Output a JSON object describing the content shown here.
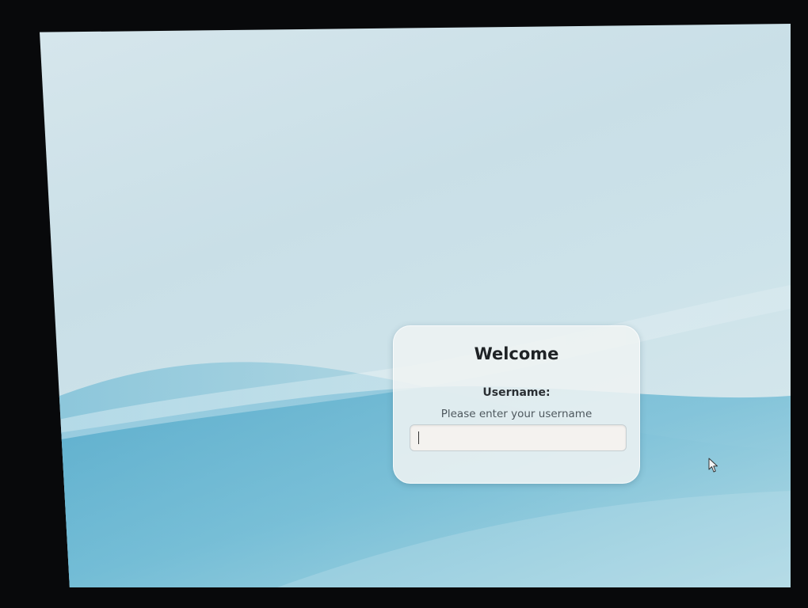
{
  "login": {
    "title": "Welcome",
    "username_label": "Username:",
    "username_hint": "Please enter your username",
    "username_value": ""
  },
  "icons": {
    "pointer": "mouse-pointer-icon",
    "caret": "text-cursor"
  },
  "colors": {
    "wallpaper_light": "#d6e6ec",
    "wallpaper_wave": "#5fb0cf",
    "card_background": "#eef2f2",
    "title_text": "#1f2326"
  }
}
